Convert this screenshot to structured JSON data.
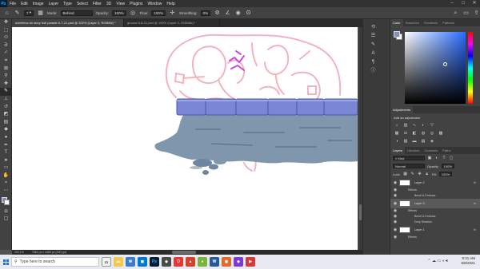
{
  "menu": {
    "logo": "Ps",
    "items": [
      "File",
      "Edit",
      "Image",
      "Layer",
      "Type",
      "Select",
      "Filter",
      "3D",
      "View",
      "Plugins",
      "Window",
      "Help"
    ],
    "window_controls": [
      "–",
      "□",
      "✕"
    ]
  },
  "options": {
    "mode_label": "Mode:",
    "mode_value": "Behind",
    "opacity_label": "Opacity:",
    "opacity_value": "100%",
    "flow_label": "Flow:",
    "flow_value": "100%",
    "smoothing_label": "Smoothing:",
    "smoothing_value": "0%",
    "brush_size": "7"
  },
  "tabs": [
    {
      "label": "dobrimus do story hull parade 6-7-21.psd @ 202% (Layer 3, RGB/8#) *",
      "active": true
    },
    {
      "label": "ground 6-8-21.psd @ 100% (Layer 2, RGB/8#) *",
      "active": false
    }
  ],
  "status": {
    "zoom": "202.1%",
    "doc_size": "7862 px x 4480 px (300 ppi)"
  },
  "panels": {
    "color_tabs": [
      "Color",
      "Swatches",
      "Gradients",
      "Patterns"
    ],
    "adjustments_title": "Adjustments",
    "add_adjustment": "Add an adjustment",
    "layer_tabs": [
      "Layers",
      "Libraries",
      "Channels",
      "Paths"
    ],
    "kind_label": "Kind",
    "blend_mode": "Normal",
    "opacity_label": "Opacity:",
    "opacity_value": "100%",
    "lock_label": "Lock:",
    "fill_label": "Fill:",
    "fill_value": "100%"
  },
  "layers": [
    {
      "type": "layer",
      "name": "Layer 2",
      "fx": "fx",
      "selected": false
    },
    {
      "type": "sub",
      "name": "Effects"
    },
    {
      "type": "sub2",
      "name": "Bevel & Emboss"
    },
    {
      "type": "layer",
      "name": "Layer 3",
      "fx": "fx",
      "selected": true
    },
    {
      "type": "sub",
      "name": "Effects"
    },
    {
      "type": "sub2",
      "name": "Bevel & Emboss"
    },
    {
      "type": "sub2",
      "name": "Drop Shadow"
    },
    {
      "type": "layer",
      "name": "Layer 1",
      "fx": "fx",
      "selected": false
    },
    {
      "type": "sub",
      "name": "Effects"
    }
  ],
  "taskbar": {
    "search_placeholder": "Type here to search",
    "time": "8:31 AM",
    "date": "6/8/2021"
  },
  "colors": {
    "foreground": "#7f8ec4",
    "brick": "#7b86d6",
    "ground": "#7f96ad",
    "sketch": "#f0a8b4",
    "magenta": "#d04ad8"
  }
}
